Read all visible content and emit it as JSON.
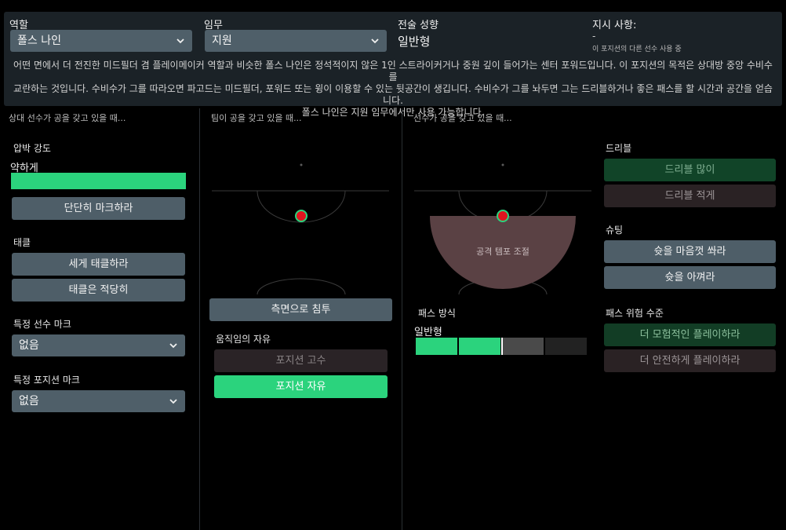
{
  "header": {
    "role_label": "역할",
    "role_value": "폴스 나인",
    "duty_label": "임무",
    "duty_value": "지원",
    "style_label": "전술 성향",
    "style_value": "일반형",
    "instr_label": "지시 사항:",
    "instr_dash": "-",
    "instr_note": "이 포지션의 다른 선수 사용 중",
    "description": [
      "어떤 면에서 더 전진한 미드필더 겸 플레이메이커 역할과 비슷한 폴스 나인은 정석적이지 않은 1인 스트라이커거나 중원 깊이 들어가는 센터 포워드입니다. 이 포지션의 목적은 상대방 중앙 수비수를",
      "교란하는 것입니다. 수비수가 그를 따라오면 파고드는 미드필더, 포워드 또는 윙이 이용할 수 있는 뒷공간이 생깁니다. 수비수가 그를 놔두면 그는 드리블하거나 좋은 패스를 할 시간과 공간을 얻습니다.",
      "폴스 나인은 지원 임무에서만 사용 가능합니다."
    ]
  },
  "col1": {
    "header": "상대 선수가 공을 갖고 있을 때...",
    "pressing_label": "압박 강도",
    "pressing_value": "약하게",
    "pressing_level": 1.0,
    "mark_tight": "단단히 마크하라",
    "tackle_label": "태클",
    "tackle_hard": "세게 태클하라",
    "tackle_moderate": "태클은 적당히",
    "mark_player_label": "특정 선수 마크",
    "mark_player_value": "없음",
    "mark_position_label": "특정 포지션 마크",
    "mark_position_value": "없음"
  },
  "col2": {
    "header": "팀이 공을 갖고 있을 때...",
    "wide_run": "측면으로 침투",
    "freedom_label": "움직임의 자유",
    "hold_position": "포지션 고수",
    "roam": "포지션 자유"
  },
  "col3": {
    "header": "선수가 공을 갖고 있을 때...",
    "zone_label": "공격 템포 조절",
    "passing_label": "패스 방식",
    "passing_value": "일반형",
    "passing_level": 0.5,
    "dribble_label": "드리블",
    "dribble_more": "드리블 많이",
    "dribble_less": "드리블 적게",
    "shoot_label": "슈팅",
    "shoot_more": "슛을 마음껏 쏴라",
    "shoot_less": "슛을 아껴라",
    "risk_label": "패스 위험 수준",
    "risk_more": "더 모험적인 플레이하라",
    "risk_less": "더 안전하게 플레이하라"
  },
  "colors": {
    "panel": "#1b2227",
    "button": "#4e5e68",
    "accent_green": "#2bd37d",
    "player_red": "#e0141e",
    "zone_fill": "#5a4144"
  }
}
